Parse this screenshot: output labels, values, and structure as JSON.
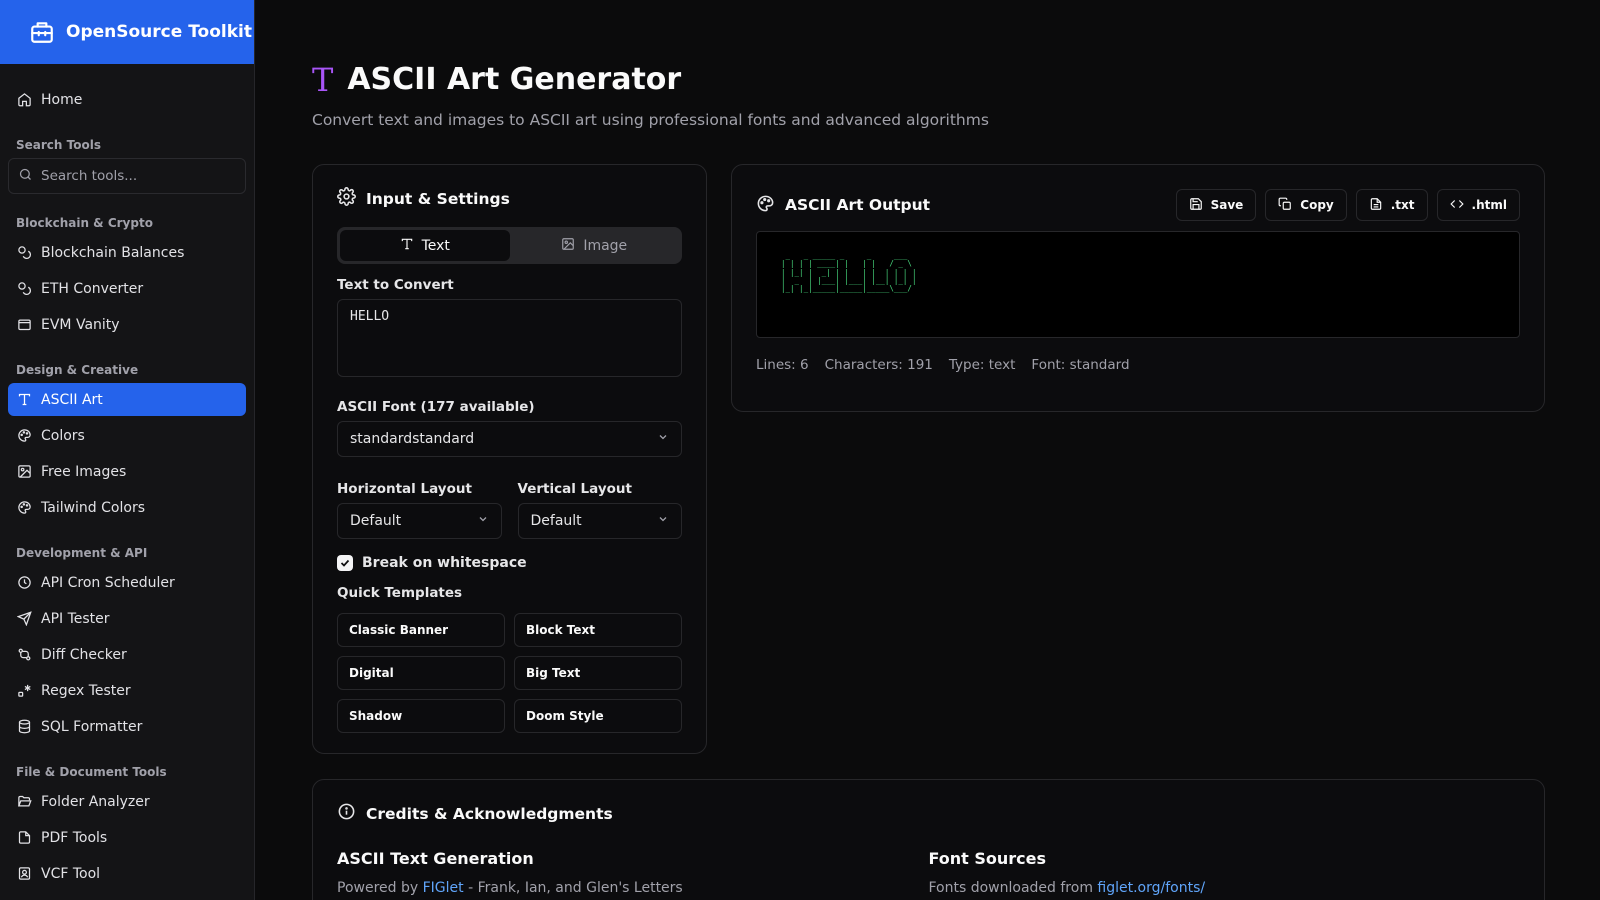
{
  "app": {
    "title": "OpenSource Toolkit"
  },
  "sidebar": {
    "home": "Home",
    "search_label": "Search Tools",
    "search_placeholder": "Search tools...",
    "sections": [
      {
        "label": "Blockchain & Crypto",
        "items": [
          {
            "label": "Blockchain Balances",
            "icon": "coins-icon"
          },
          {
            "label": "ETH Converter",
            "icon": "coins-icon"
          },
          {
            "label": "EVM Vanity",
            "icon": "wallet-icon"
          }
        ]
      },
      {
        "label": "Design & Creative",
        "items": [
          {
            "label": "ASCII Art",
            "icon": "type-icon",
            "active": true
          },
          {
            "label": "Colors",
            "icon": "palette-icon"
          },
          {
            "label": "Free Images",
            "icon": "image-icon"
          },
          {
            "label": "Tailwind Colors",
            "icon": "palette-icon"
          }
        ]
      },
      {
        "label": "Development & API",
        "items": [
          {
            "label": "API Cron Scheduler",
            "icon": "clock-icon"
          },
          {
            "label": "API Tester",
            "icon": "send-icon"
          },
          {
            "label": "Diff Checker",
            "icon": "git-compare-icon"
          },
          {
            "label": "Regex Tester",
            "icon": "regex-icon"
          },
          {
            "label": "SQL Formatter",
            "icon": "database-icon"
          }
        ]
      },
      {
        "label": "File & Document Tools",
        "items": [
          {
            "label": "Folder Analyzer",
            "icon": "folder-open-icon"
          },
          {
            "label": "PDF Tools",
            "icon": "file-icon"
          },
          {
            "label": "VCF Tool",
            "icon": "contact-icon"
          }
        ]
      }
    ]
  },
  "page": {
    "title": "ASCII Art Generator",
    "subtitle": "Convert text and images to ASCII art using professional fonts and advanced algorithms"
  },
  "input": {
    "title": "Input & Settings",
    "tabs": {
      "text": "Text",
      "image": "Image"
    },
    "text_label": "Text to Convert",
    "text_value": "HELLO",
    "font_label": "ASCII Font (177 available)",
    "font_value": "standardstandard",
    "h_layout_label": "Horizontal Layout",
    "h_layout_value": "Default",
    "v_layout_label": "Vertical Layout",
    "v_layout_value": "Default",
    "break_label": "Break on whitespace",
    "break_checked": true,
    "templates_label": "Quick Templates",
    "templates": [
      "Classic Banner",
      "Block Text",
      "Digital",
      "Big Text",
      "Shadow",
      "Doom Style"
    ]
  },
  "output": {
    "title": "ASCII Art Output",
    "actions": {
      "save": "Save",
      "copy": "Copy",
      "txt": ".txt",
      "html": ".html"
    },
    "ascii": " _   _ _____ _     _     ___  \n| | | | ____| |   | |   / _ \\ \n| |_| |  _| | |   | |  | | | |\n|  _  | |___| |___| |__| |_| |\n|_| |_|_____|_____|_____\\___/ \n",
    "stats": {
      "lines": "Lines: 6",
      "characters": "Characters: 191",
      "type": "Type: text",
      "font": "Font: standard"
    }
  },
  "credits": {
    "title": "Credits & Acknowledgments",
    "col1": {
      "heading": "ASCII Text Generation",
      "prefix": "Powered by ",
      "link": "FIGlet",
      "suffix": " - Frank, Ian, and Glen's Letters"
    },
    "col2": {
      "heading": "Font Sources",
      "prefix": "Fonts downloaded from ",
      "link": "figlet.org/fonts/"
    }
  },
  "colors": {
    "accent": "#2563eb",
    "title_icon": "#a855f7",
    "ascii_text": "#4ade80",
    "link": "#60a5fa"
  }
}
